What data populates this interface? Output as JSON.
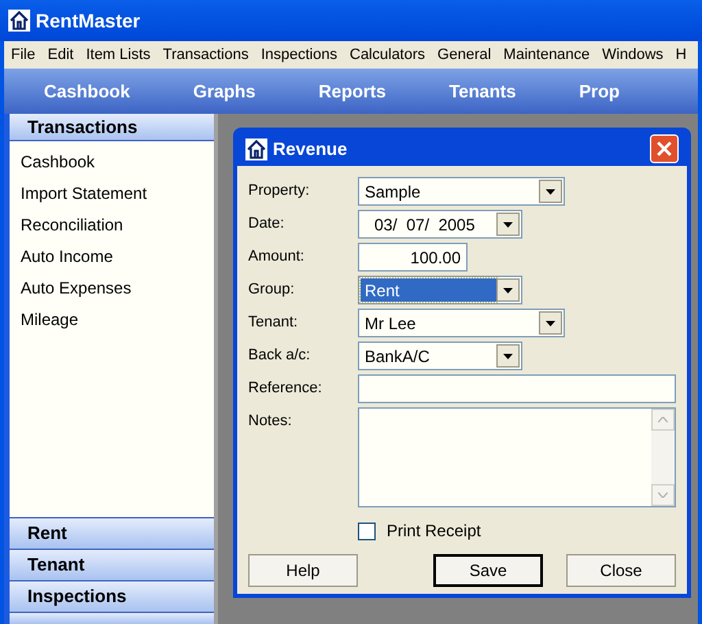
{
  "window": {
    "title": "RentMaster"
  },
  "menu": [
    "File",
    "Edit",
    "Item Lists",
    "Transactions",
    "Inspections",
    "Calculators",
    "General",
    "Maintenance",
    "Windows",
    "H"
  ],
  "nav": [
    "Cashbook",
    "Graphs",
    "Reports",
    "Tenants",
    "Prop"
  ],
  "sidebar": {
    "open_section": {
      "title": "Transactions",
      "items": [
        "Cashbook",
        "Import Statement",
        "Reconciliation",
        "Auto Income",
        "Auto Expenses",
        "Mileage"
      ]
    },
    "sections": [
      "Rent",
      "Tenant",
      "Inspections"
    ]
  },
  "dialog": {
    "title": "Revenue",
    "fields": [
      {
        "kind": "select",
        "label": "Property:",
        "value": "Sample",
        "wide": true,
        "highlighted": false
      },
      {
        "kind": "date",
        "label": "Date:",
        "value": "03/  07/  2005",
        "wide": false,
        "highlighted": false
      },
      {
        "kind": "number",
        "label": "Amount:",
        "value": "100.00",
        "wide": false,
        "highlighted": false
      },
      {
        "kind": "select",
        "label": "Group:",
        "value": "Rent",
        "wide": false,
        "highlighted": true
      },
      {
        "kind": "select",
        "label": "Tenant:",
        "value": "Mr Lee",
        "wide": true,
        "highlighted": false
      },
      {
        "kind": "select",
        "label": "Back a/c:",
        "value": "BankA/C",
        "wide": false,
        "highlighted": false
      },
      {
        "kind": "text",
        "label": "Reference:",
        "wide": true,
        "highlighted": false
      },
      {
        "kind": "textarea",
        "label": "Notes:",
        "wide": true,
        "highlighted": false
      }
    ],
    "print_receipt": {
      "label": "Print Receipt",
      "checked": false
    },
    "buttons": [
      {
        "label": "Help",
        "default": false
      },
      {
        "label": "Save",
        "default": true
      },
      {
        "label": "Close",
        "default": false
      }
    ]
  }
}
